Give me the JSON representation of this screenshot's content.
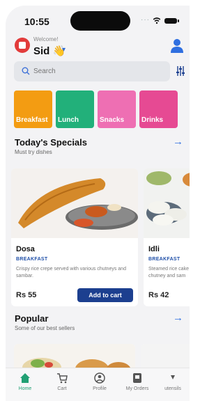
{
  "status_bar": {
    "time": "10:55"
  },
  "header": {
    "welcome": "Welcome!",
    "username": "Sid 👋"
  },
  "search": {
    "placeholder": "Search"
  },
  "categories": [
    {
      "label": "Breakfast",
      "color": "#f39c12"
    },
    {
      "label": "Lunch",
      "color": "#22b07a"
    },
    {
      "label": "Snacks",
      "color": "#ee6fb3"
    },
    {
      "label": "Drinks",
      "color": "#e64a93"
    }
  ],
  "specials": {
    "title": "Today's Specials",
    "subtitle": "Must try dishes",
    "items": [
      {
        "name": "Dosa",
        "category": "BREAKFAST",
        "description": "Crispy rice crepe served with various chutneys and sambar.",
        "price": "Rs 55",
        "button": "Add to cart"
      },
      {
        "name": "Idli",
        "category": "BREAKFAST",
        "description": "Steamed rice cake chutney and sam",
        "price": "Rs 42"
      }
    ]
  },
  "popular": {
    "title": "Popular",
    "subtitle": "Some of our best sellers"
  },
  "tabs": [
    {
      "label": "Home",
      "icon": "home-icon"
    },
    {
      "label": "Cart",
      "icon": "cart-icon"
    },
    {
      "label": "Profile",
      "icon": "profile-icon"
    },
    {
      "label": "My Orders",
      "icon": "orders-icon"
    },
    {
      "label": "utensils",
      "icon": "utensils-icon"
    }
  ],
  "colors": {
    "accent": "#2f6fe0",
    "button": "#1c3f8f",
    "active_tab": "#22a074"
  }
}
